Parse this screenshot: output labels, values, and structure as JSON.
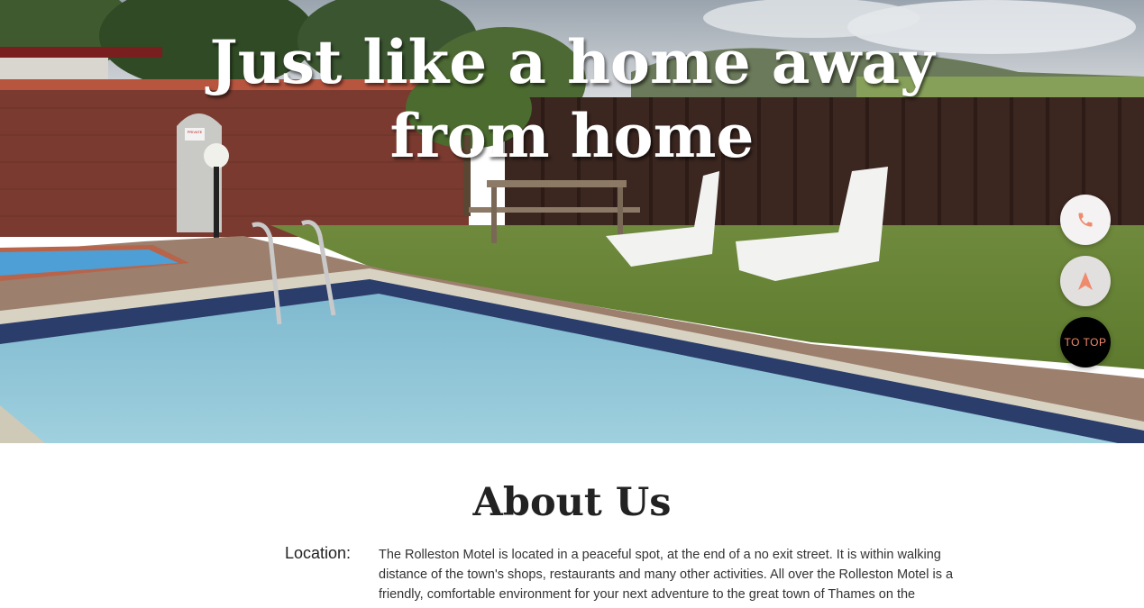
{
  "hero": {
    "title_line1": "Just like a home away",
    "title_line2": "from home",
    "sign_text": "PRIVATE KEEP OUT"
  },
  "actions": {
    "call_icon": "phone-icon",
    "directions_icon": "navigation-arrow-icon",
    "to_top_label": "TO TOP",
    "accent_color": "#f08a6c"
  },
  "about": {
    "heading": "About Us",
    "location_label": "Location:",
    "location_text": "The Rolleston Motel is located in a peaceful spot, at the end of a no exit street. It is within walking distance of the town's shops, restaurants and many other activities. All over the Rolleston Motel is a friendly, comfortable environment for your next adventure to the great town of Thames on the"
  }
}
